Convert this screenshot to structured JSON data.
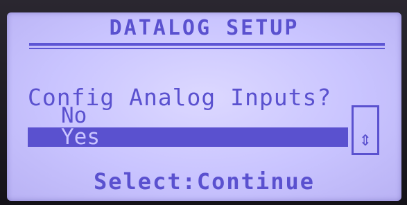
{
  "screen": {
    "title": "DATALOG SETUP",
    "prompt": "Config Analog Inputs?",
    "options": [
      {
        "label": "No",
        "selected": false
      },
      {
        "label": "Yes",
        "selected": true
      }
    ],
    "scroll_icon": "up-down-arrow-icon",
    "footer": "Select:Continue"
  },
  "colors": {
    "lcd_background": "#c9c4ff",
    "lcd_text": "#5a51cf"
  }
}
